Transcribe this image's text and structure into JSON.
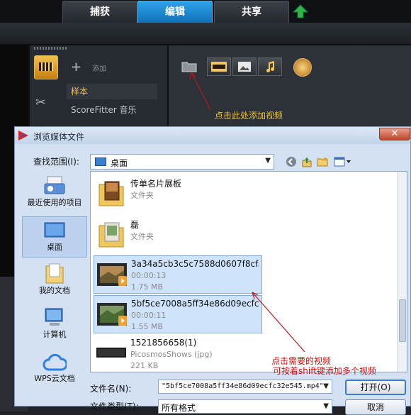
{
  "tabs": [
    {
      "label": "捕获",
      "active": false
    },
    {
      "label": "编辑",
      "active": true
    },
    {
      "label": "共享",
      "active": false
    }
  ],
  "library": {
    "add_label": "添加",
    "categories": [
      "样本",
      "ScoreFitter 音乐"
    ]
  },
  "annotations": {
    "add_video": "点击此处添加视频",
    "select_line1": "点击需要的视频",
    "select_line2": "可按着shift键添加多个视频"
  },
  "dialog": {
    "title": "浏览媒体文件",
    "look_in_label": "查找范围(I):",
    "look_in_value": "桌面",
    "places": [
      {
        "label": "最近使用的项目",
        "icon": "recent-items-icon"
      },
      {
        "label": "桌面",
        "icon": "desktop-icon",
        "selected": true
      },
      {
        "label": "我的文档",
        "icon": "my-documents-icon"
      },
      {
        "label": "计算机",
        "icon": "computer-icon"
      },
      {
        "label": "WPS云文档",
        "icon": "wps-cloud-icon"
      }
    ],
    "files": [
      {
        "name": "传单名片展板",
        "line1": "文件夹",
        "line2": "",
        "kind": "folder",
        "selected": false
      },
      {
        "name": "磊",
        "line1": "文件夹",
        "line2": "",
        "kind": "folder",
        "selected": false
      },
      {
        "name": "3a34a5cb3c5c7588d0607f8cf...",
        "line1": "00:00:13",
        "line2": "1.75 MB",
        "kind": "video",
        "selected": true
      },
      {
        "name": "5bf5ce7008a5ff34e86d09ecfc...",
        "line1": "00:00:11",
        "line2": "1.55 MB",
        "kind": "video",
        "selected": true
      },
      {
        "name": "1521856658(1)",
        "line1": "PicosmosShows (jpg)",
        "line2": "221 KB",
        "kind": "image",
        "selected": false
      }
    ],
    "filename_label": "文件名(N):",
    "filename_value": "\"5bf5ce7008a5ff34e86d09ecfc32e545.mp4\"",
    "filetype_label": "文件类型(T):",
    "filetype_value": "所有格式",
    "open_label": "打开(O)",
    "cancel_label": "取消"
  },
  "colors": {
    "active_tab": "#1e8ad6",
    "annotation": "#ffd23c",
    "arrow": "#c0141c",
    "selection": "#cfe3fb"
  }
}
